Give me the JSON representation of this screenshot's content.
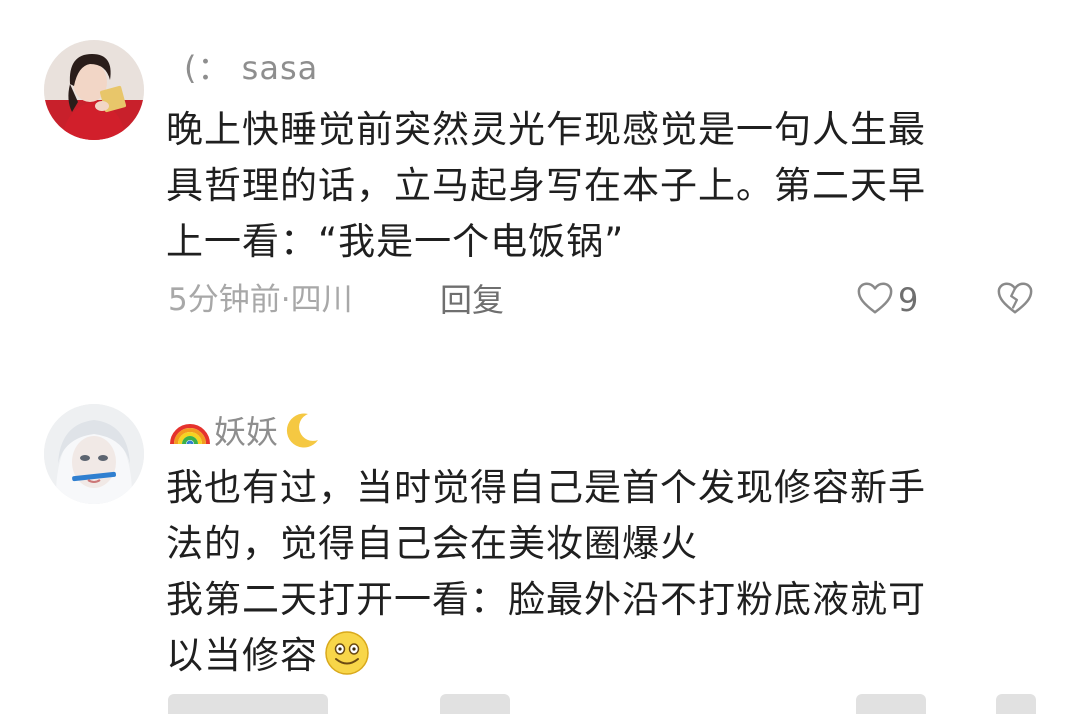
{
  "comments": [
    {
      "username": "(：  sasa",
      "lines": [
        "晚上快睡觉前突然灵光乍现感觉是一句人生最",
        "具哲理的话，立马起身写在本子上。第二天早",
        "上一看：“我是一个电饭锅”"
      ],
      "time_location": "5分钟前·四川",
      "reply_label": "回复",
      "like_count": "9",
      "icons": {
        "like": "heart-outline-icon",
        "dislike": "broken-heart-icon"
      }
    },
    {
      "username": "妖妖",
      "username_emojis": [
        "rainbow-emoji",
        "crescent-moon-emoji"
      ],
      "lines": [
        "我也有过，当时觉得自己是首个发现修容新手",
        "法的，觉得自己会在美妆圈爆火",
        "我第二天打开一看：脸最外沿不打粉底液就可",
        "以当修容"
      ],
      "inline_emoji": "smiley-emoji"
    }
  ],
  "colors": {
    "text": "#1f1f1f",
    "muted": "#a8a8a8",
    "username": "#8e8e8e"
  }
}
